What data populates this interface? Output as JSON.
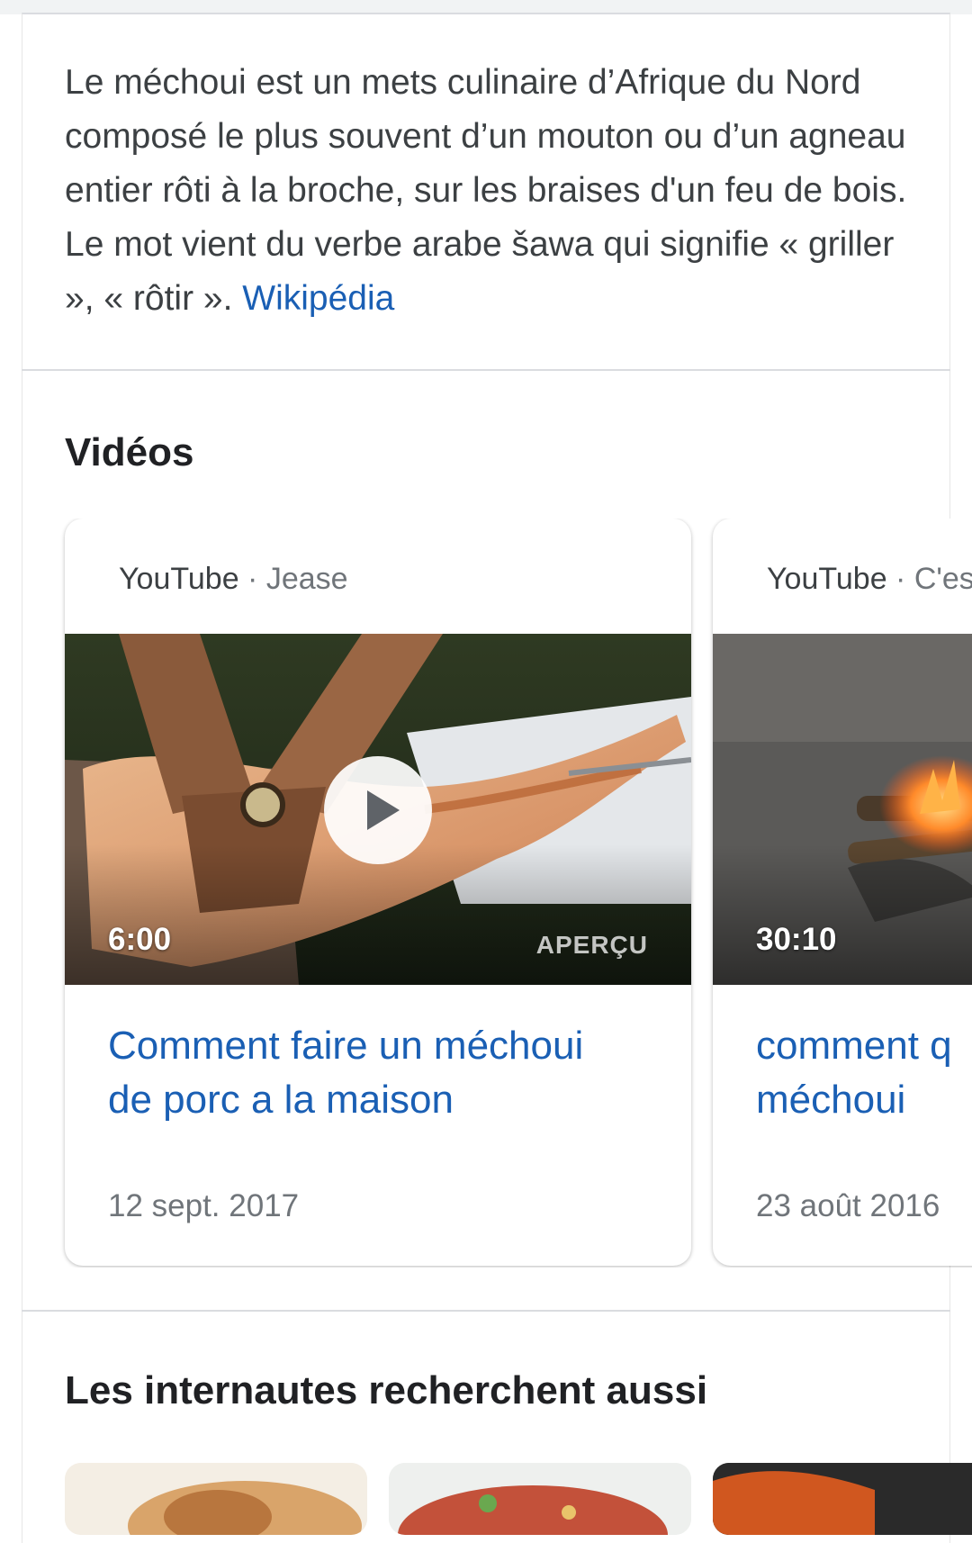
{
  "knowledge_panel": {
    "description": "Le méchoui est un mets culinaire d’Afrique du Nord composé le plus souvent d’un mouton ou d’un agneau entier rôti à la broche, sur les braises d'un feu de bois. Le mot vient du verbe arabe šawa qui signifie « griller », « rôtir ».",
    "source_link": "Wikipédia"
  },
  "videos": {
    "heading": "Vidéos",
    "items": [
      {
        "platform": "YouTube",
        "separator": " · ",
        "channel": "Jease",
        "duration": "6:00",
        "preview_label": "APERÇU",
        "title_line1": "Comment faire un méchoui",
        "title_line2": "de porc a la maison",
        "date": "12 sept. 2017",
        "icon": "play-icon"
      },
      {
        "platform": "YouTube",
        "separator": " · ",
        "channel": "C'es",
        "duration": "30:10",
        "title_line1": "comment q",
        "title_line2": "méchoui",
        "date": "23 août 2016"
      }
    ]
  },
  "related_searches": {
    "heading": "Les internautes recherchent aussi"
  },
  "colors": {
    "link": "#1a5fb4",
    "text": "#3c4043",
    "heading": "#202124",
    "muted": "#70757a",
    "divider": "#dadce0"
  }
}
